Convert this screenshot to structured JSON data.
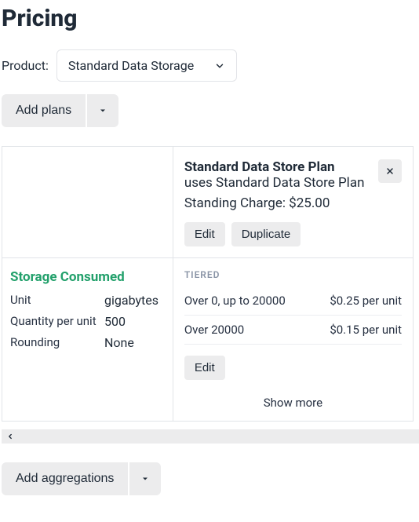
{
  "title": "Pricing",
  "product": {
    "label": "Product:",
    "selected": "Standard Data Storage"
  },
  "add_plans_label": "Add plans",
  "plan": {
    "name": "Standard Data Store Plan",
    "subname": "uses Standard Data Store Plan",
    "standing_charge_label": "Standing Charge: $25.00",
    "edit_label": "Edit",
    "duplicate_label": "Duplicate"
  },
  "aggregation": {
    "name": "Storage Consumed",
    "rows": [
      {
        "key": "Unit",
        "value": "gigabytes"
      },
      {
        "key": "Quantity per unit",
        "value": "500"
      },
      {
        "key": "Rounding",
        "value": "None"
      }
    ]
  },
  "tiers": {
    "caption": "TIERED",
    "rows": [
      {
        "range": "Over 0, up to 20000",
        "price": "$0.25 per unit"
      },
      {
        "range": "Over 20000",
        "price": "$0.15 per unit"
      }
    ],
    "edit_label": "Edit",
    "show_more_label": "Show more"
  },
  "add_aggregations_label": "Add aggregations"
}
